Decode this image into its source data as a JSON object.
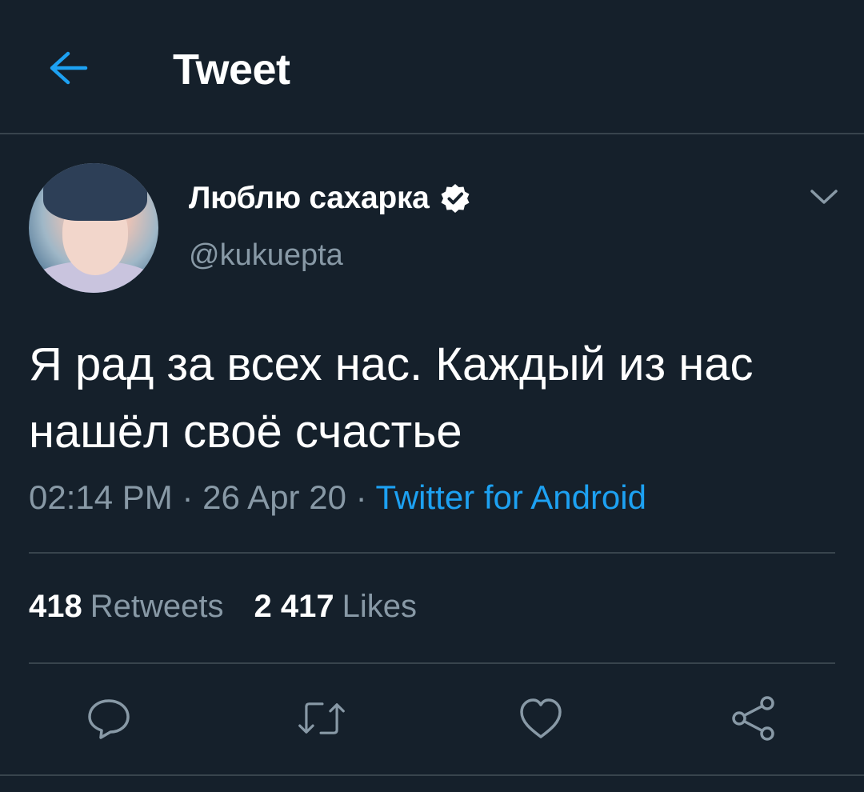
{
  "header": {
    "back_icon": "back-arrow-icon",
    "title": "Tweet",
    "accent": "#1da1f2"
  },
  "tweet": {
    "display_name": "Люблю сахарка",
    "verified": true,
    "handle": "@kukuepta",
    "text": "Я рад за всех нас. Каждый из нас нашёл своё счастье",
    "time": "02:14 PM",
    "separator": " · ",
    "date": "26 Apr 20",
    "source": "Twitter for Android"
  },
  "stats": {
    "retweets_count": "418",
    "retweets_label": "Retweets",
    "likes_count": "2 417",
    "likes_label": "Likes"
  },
  "actions": [
    "reply-icon",
    "retweet-icon",
    "like-icon",
    "share-icon"
  ],
  "colors": {
    "background": "#15202b",
    "divider": "#38444d",
    "secondary_text": "#8899a6",
    "link": "#1da1f2"
  }
}
